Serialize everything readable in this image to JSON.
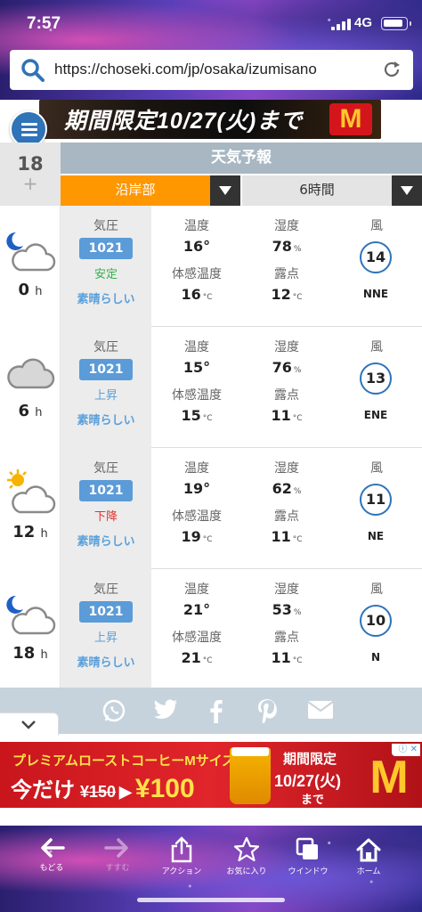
{
  "status": {
    "time": "7:57",
    "network": "4G"
  },
  "browser": {
    "url": "https://choseki.com/jp/osaka/izumisano"
  },
  "ad_top": {
    "text": "期間限定10/27(火)まで",
    "logo": "M"
  },
  "header": {
    "day": "18",
    "plus": "+",
    "title": "天気予報",
    "area_select": "沿岸部",
    "interval_select": "6時間"
  },
  "labels": {
    "pressure": "気圧",
    "temp": "温度",
    "feels": "体感温度",
    "humidity": "湿度",
    "dewpoint": "露点",
    "wind": "風",
    "hour_unit": "h",
    "deg": "°",
    "pct": "%",
    "celsius": "°C"
  },
  "forecast": [
    {
      "hour": "0",
      "icon": "moon-cloud-icon",
      "pressure": "1021",
      "trend": "安定",
      "trend_color": "#33b04a",
      "condition": "素晴らしい",
      "temp": "16",
      "feels": "16",
      "humidity": "78",
      "dew": "12",
      "wind_speed": "14",
      "wind_dir": "NNE"
    },
    {
      "hour": "6",
      "icon": "cloud-icon",
      "pressure": "1021",
      "trend": "上昇",
      "trend_color": "#5aa0dc",
      "condition": "素晴らしい",
      "temp": "15",
      "feels": "15",
      "humidity": "76",
      "dew": "11",
      "wind_speed": "13",
      "wind_dir": "ENE"
    },
    {
      "hour": "12",
      "icon": "sun-cloud-icon",
      "pressure": "1021",
      "trend": "下降",
      "trend_color": "#e2332c",
      "condition": "素晴らしい",
      "temp": "19",
      "feels": "19",
      "humidity": "62",
      "dew": "11",
      "wind_speed": "11",
      "wind_dir": "NE"
    },
    {
      "hour": "18",
      "icon": "moon-cloud-icon",
      "pressure": "1021",
      "trend": "上昇",
      "trend_color": "#5aa0dc",
      "condition": "素晴らしい",
      "temp": "21",
      "feels": "21",
      "humidity": "53",
      "dew": "11",
      "wind_speed": "10",
      "wind_dir": "N"
    }
  ],
  "ad_bottom": {
    "line1": "プレミアムローストコーヒーMサイズ",
    "line2": "今だけ",
    "old_price": "¥150",
    "new_price": "¥100",
    "r1": "期間限定",
    "r2": "10/27(火)",
    "r3": "まで",
    "logo": "M",
    "close": "ⓘ ✕"
  },
  "toolbar": {
    "back": "もどる",
    "forward": "すすむ",
    "action": "アクション",
    "bookmark": "お気に入り",
    "window": "ウインドウ",
    "home": "ホーム"
  }
}
